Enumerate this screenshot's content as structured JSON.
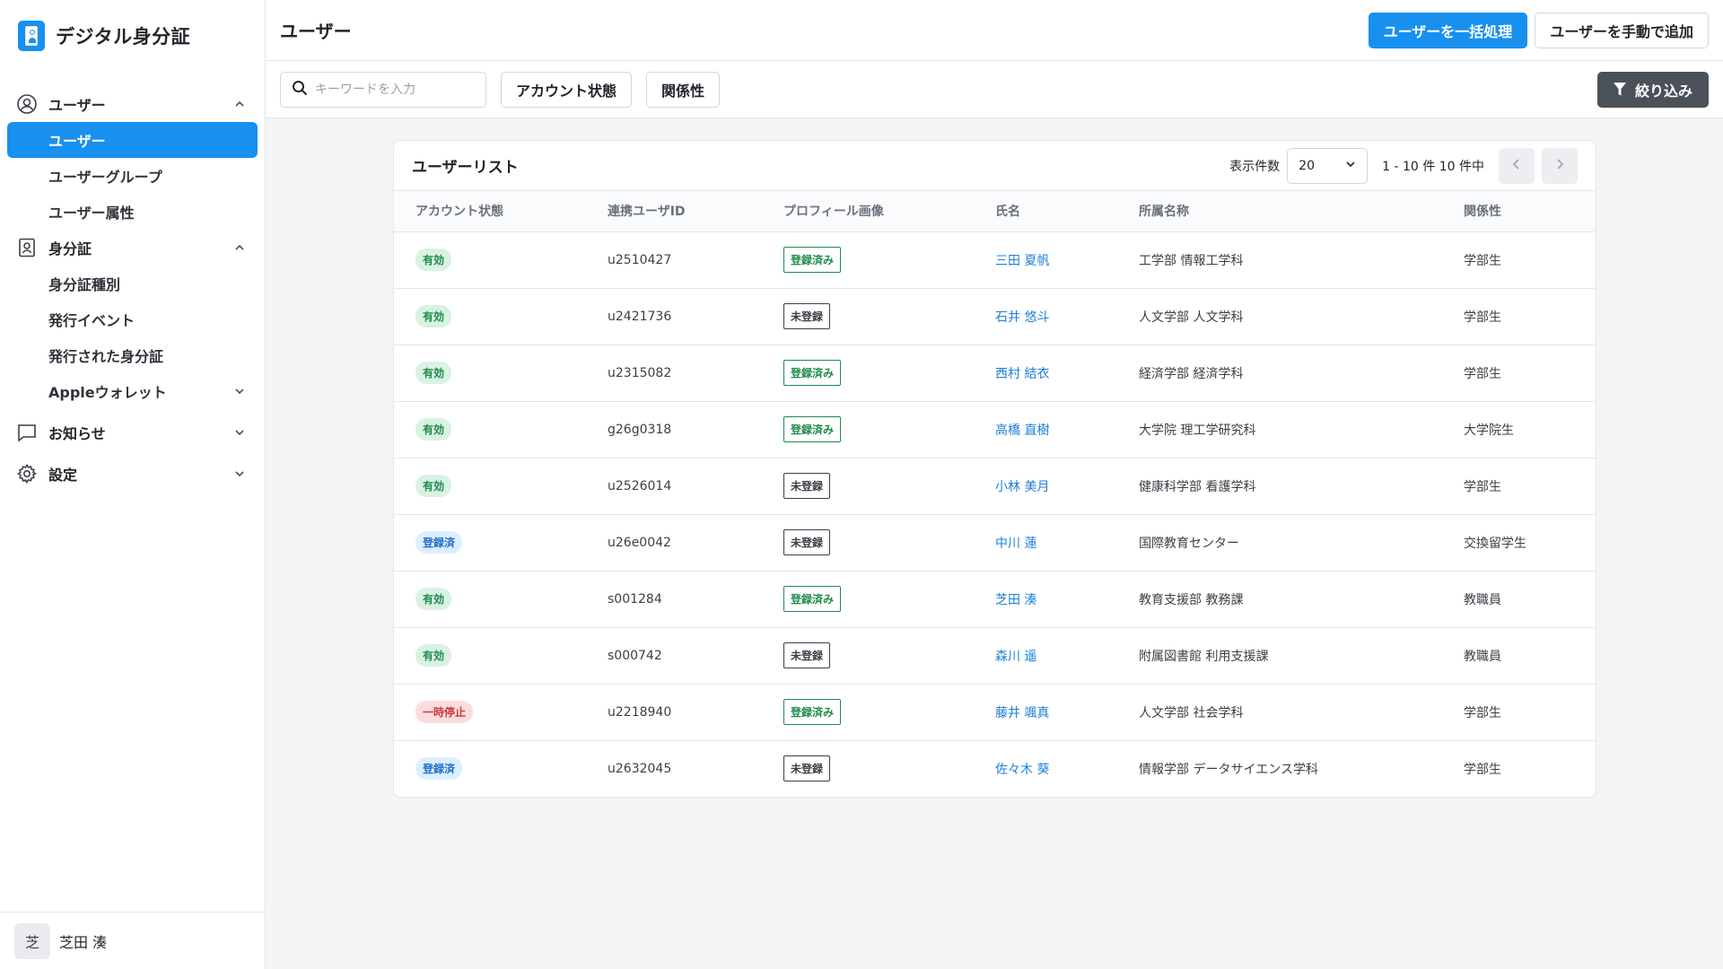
{
  "app": {
    "title": "デジタル身分証"
  },
  "sidebar": {
    "groups": [
      {
        "label": "ユーザー",
        "icon": "user-circle-icon",
        "expanded": true,
        "items": [
          "ユーザー",
          "ユーザーグループ",
          "ユーザー属性"
        ]
      },
      {
        "label": "身分証",
        "icon": "id-card-icon",
        "expanded": true,
        "items": [
          "身分証種別",
          "発行イベント",
          "発行された身分証",
          "Appleウォレット"
        ]
      },
      {
        "label": "お知らせ",
        "icon": "chat-bubble-icon",
        "expanded": false
      },
      {
        "label": "設定",
        "icon": "gear-icon",
        "expanded": false
      }
    ],
    "user": {
      "avatar_initial": "芝",
      "name": "芝田 湊"
    }
  },
  "header": {
    "title": "ユーザー",
    "bulk_button": "ユーザーを一括処理",
    "add_button": "ユーザーを手動で追加"
  },
  "filters": {
    "search_placeholder": "キーワードを入力",
    "account_status": "アカウント状態",
    "relation": "関係性",
    "filter_button": "絞り込み"
  },
  "list": {
    "title": "ユーザーリスト",
    "per_page_label": "表示件数",
    "per_page_value": "20",
    "range_text": "1 - 10 件 10 件中",
    "columns": [
      "アカウント状態",
      "連携ユーザID",
      "プロフィール画像",
      "氏名",
      "所属名称",
      "関係性"
    ],
    "rows": [
      {
        "status": "有効",
        "status_type": "active",
        "uid": "u2510427",
        "profile": "登録済み",
        "profile_type": "yes",
        "name": "三田 夏帆",
        "affiliation": "工学部 情報工学科",
        "relation": "学部生"
      },
      {
        "status": "有効",
        "status_type": "active",
        "uid": "u2421736",
        "profile": "未登録",
        "profile_type": "no",
        "name": "石井 悠斗",
        "affiliation": "人文学部 人文学科",
        "relation": "学部生"
      },
      {
        "status": "有効",
        "status_type": "active",
        "uid": "u2315082",
        "profile": "登録済み",
        "profile_type": "yes",
        "name": "西村 結衣",
        "affiliation": "経済学部 経済学科",
        "relation": "学部生"
      },
      {
        "status": "有効",
        "status_type": "active",
        "uid": "g26g0318",
        "profile": "登録済み",
        "profile_type": "yes",
        "name": "高橋 直樹",
        "affiliation": "大学院 理工学研究科",
        "relation": "大学院生"
      },
      {
        "status": "有効",
        "status_type": "active",
        "uid": "u2526014",
        "profile": "未登録",
        "profile_type": "no",
        "name": "小林 美月",
        "affiliation": "健康科学部 看護学科",
        "relation": "学部生"
      },
      {
        "status": "登録済",
        "status_type": "registered",
        "uid": "u26e0042",
        "profile": "未登録",
        "profile_type": "no",
        "name": "中川 蓮",
        "affiliation": "国際教育センター",
        "relation": "交換留学生"
      },
      {
        "status": "有効",
        "status_type": "active",
        "uid": "s001284",
        "profile": "登録済み",
        "profile_type": "yes",
        "name": "芝田 湊",
        "affiliation": "教育支援部 教務課",
        "relation": "教職員"
      },
      {
        "status": "有効",
        "status_type": "active",
        "uid": "s000742",
        "profile": "未登録",
        "profile_type": "no",
        "name": "森川 遥",
        "affiliation": "附属図書館 利用支援課",
        "relation": "教職員"
      },
      {
        "status": "一時停止",
        "status_type": "suspended",
        "uid": "u2218940",
        "profile": "登録済み",
        "profile_type": "yes",
        "name": "藤井 颯真",
        "affiliation": "人文学部 社会学科",
        "relation": "学部生"
      },
      {
        "status": "登録済",
        "status_type": "registered",
        "uid": "u2632045",
        "profile": "未登録",
        "profile_type": "no",
        "name": "佐々木 葵",
        "affiliation": "情報学部 データサイエンス学科",
        "relation": "学部生"
      }
    ]
  },
  "colors": {
    "accent": "#1890f0",
    "link": "#1c7fd8",
    "dark_button": "#4b5159"
  }
}
